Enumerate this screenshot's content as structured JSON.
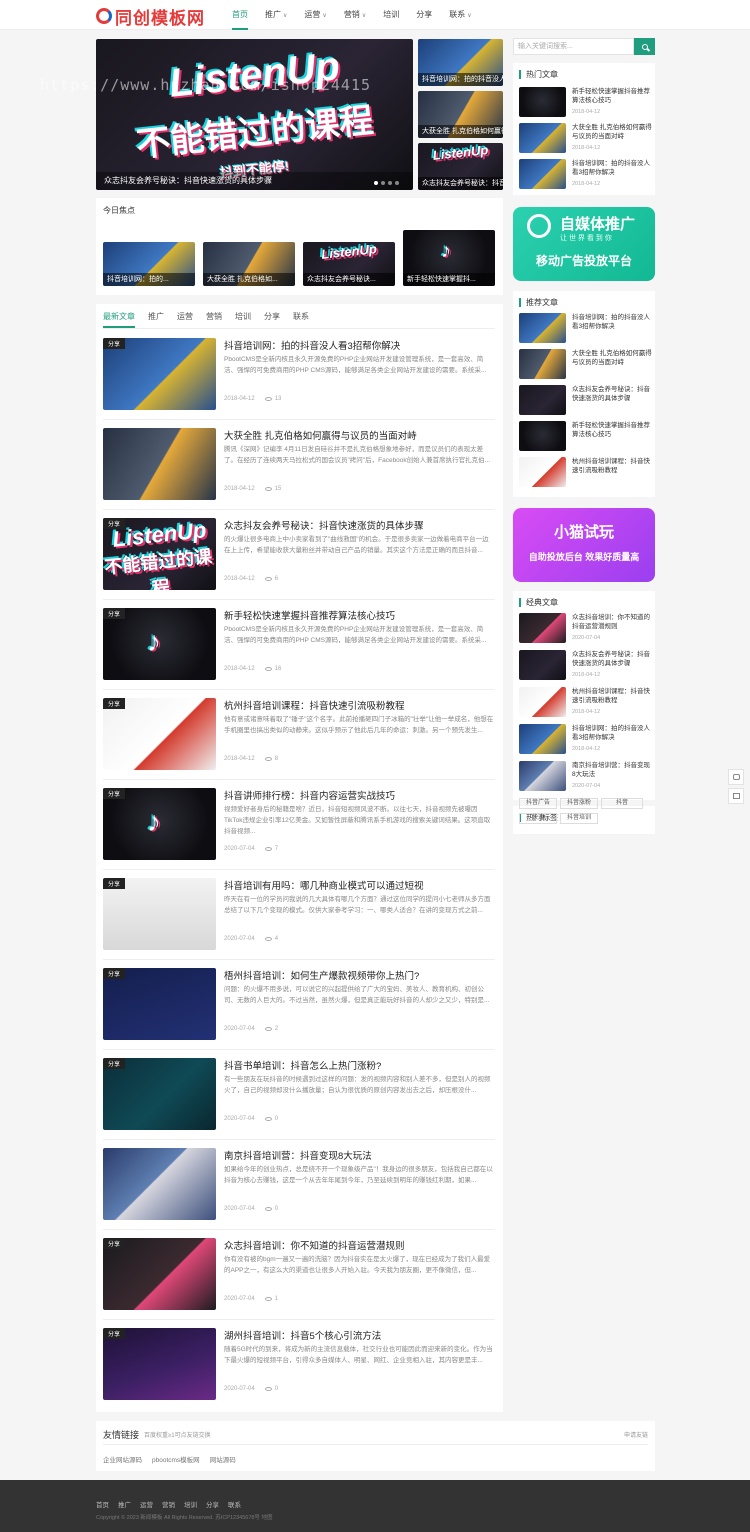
{
  "site": {
    "logo_text": "同创模板网"
  },
  "nav": [
    {
      "label": "首页",
      "active": true,
      "dropdown": false
    },
    {
      "label": "推广",
      "active": false,
      "dropdown": true
    },
    {
      "label": "运营",
      "active": false,
      "dropdown": true
    },
    {
      "label": "营销",
      "active": false,
      "dropdown": true
    },
    {
      "label": "培训",
      "active": false,
      "dropdown": false
    },
    {
      "label": "分享",
      "active": false,
      "dropdown": false
    },
    {
      "label": "联系",
      "active": false,
      "dropdown": true
    }
  ],
  "watermark": "https://www.huzhan.com/ishop24415",
  "slider": {
    "title_line1": "ListenUp",
    "title_line2": "不能错过的课程",
    "title_line3": "抖到不能停!",
    "caption": "众志抖友会养号秘诀：抖音快速涨货的具体步骤",
    "side": [
      {
        "caption": "抖音培训网：拍的抖音没人..."
      },
      {
        "caption": "大获全胜 扎克伯格如何赢得..."
      },
      {
        "caption": "众志抖友会养号秘诀：抖音..."
      }
    ]
  },
  "focus": {
    "title": "今日焦点",
    "items": [
      "抖音培训网：拍的...",
      "大获全胜 扎克伯格如...",
      "众志抖友会养号秘诀...",
      "新手轻松快速掌握抖..."
    ]
  },
  "tabs": [
    "最新文章",
    "推广",
    "运营",
    "营销",
    "培训",
    "分享",
    "联系"
  ],
  "articles": [
    {
      "tag": "分享",
      "title": "抖音培训网：拍的抖音没人看3招帮你解决",
      "desc": "PbootCMS是全新内核且永久开源免费的PHP企业网站开发建设管理系统，是一套高效、简洁、强悍的可免费商用的PHP CMS源码，能够满足各类企业网站开发建设的需要。系统采...",
      "date": "2018-04-12",
      "views": "13"
    },
    {
      "tag": "",
      "title": "大获全胜 扎克伯格如何赢得与议员的当面对峙",
      "desc": "腾讯《深网》记编李 4月11日发自硅谷并不是扎克伯格想象地参好，而是议员们的表现太差了。在经历了连续两天马拉松式的国会议员\"拷问\"后，Facebook创始人兼首席执行官扎克伯...",
      "date": "2018-04-12",
      "views": "15"
    },
    {
      "tag": "分享",
      "title": "众志抖友会养号秘诀：抖音快速涨货的具体步骤",
      "desc": "的火爆让很多电商上中小卖家看到了\"曲线救国\"的机会。于是很多卖家一边做着电商平台一边在上上传，希望能收获大量粉丝并带动自己产品的销量。其实这个方法是正确的而且抖音...",
      "date": "2018-04-12",
      "views": "6"
    },
    {
      "tag": "分享",
      "title": "新手轻松快速掌握抖音推荐算法核心技巧",
      "desc": "PbootCMS是全新内核且永久开源免费的PHP企业网站开发建设管理系统，是一套高效、简洁、强悍的可免费商用的PHP CMS源码，能够满足各类企业网站开发建设的需要。系统采...",
      "date": "2018-04-12",
      "views": "16"
    },
    {
      "tag": "分享",
      "title": "杭州抖音培训课程：抖音快速引流吸粉教程",
      "desc": "他有意或诸意味着取了\"锤子\"这个名字。此前抢播砸四门子冰箱的\"壮举\"让他一举成名，他想在手机圈里也搞出类似的动静来。这似乎预示了他此后几年的命运：刺激。另一个预先发生...",
      "date": "2018-04-12",
      "views": "8"
    },
    {
      "tag": "分享",
      "title": "抖音讲师排行榜：抖音内容运营实战技巧",
      "desc": "视频爱好者身后的秘籍是啥？近日，抖音短视频风波不断。以往七天，抖音视频先被曝因TikTok违规企业引率12亿美金。又如暂性屏蔽和腾讯系手机游戏的搜索关键词结果。这项直取抖音视频...",
      "date": "2020-07-04",
      "views": "7"
    },
    {
      "tag": "分享",
      "title": "抖音培训有用吗：哪几种商业模式可以通过短视",
      "desc": "昨天在有一位的学员问我说的几大具体有哪几个方面？通过这位同学的提问小七老师从多方面总结了以下几个变现的模式。仅供大家参考学习：一、哪类人适合？在讲的变现方式之前...",
      "date": "2020-07-04",
      "views": "4"
    },
    {
      "tag": "分享",
      "title": "梧州抖音培训：如何生产爆款视频带你上热门?",
      "desc": "问题：的火爆不用多说，可以说它的兴起提供给了广大的宝妈、美妆人、教育机构、初创公司、无数的人巨大的。不过当然，虽然火爆，但是真正能玩好抖音的人却少之又少，特别是...",
      "date": "2020-07-04",
      "views": "2"
    },
    {
      "tag": "分享",
      "title": "抖音书单培训：抖音怎么上热门涨粉?",
      "desc": "有一些朋友在玩抖音的时候遇到过这样的问题：发的视频内容和别人差不多，但是别人的视频火了，自己的视频却没什么播放量；自认为很优质的原创内容发出去之后，却压根没什...",
      "date": "2020-07-04",
      "views": "0"
    },
    {
      "tag": "",
      "title": "南京抖音培训营：抖音变现8大玩法",
      "desc": "如果给今年的创业热点，总是绕不开一个现象级产品\"！我身边的很多朋友，包括我自己都在以抖音为核心去赚钱，这是一个从去年年尾到今年，乃至延续到明年的赚钱红利期，如果...",
      "date": "2020-07-04",
      "views": "0"
    },
    {
      "tag": "分享",
      "title": "众志抖音培训：你不知道的抖音运营潜规则",
      "desc": "你有没有被的bgm一遍又一遍的洗脑？因为抖音实在是太火爆了，现在已经成为了我们人最爱的APP之一，有这么大的渠道也让很多人开始入驻。今天我为朋友圈，更不像微信，但...",
      "date": "2020-07-04",
      "views": "1"
    },
    {
      "tag": "分享",
      "title": "湖州抖音培训：抖音5个核心引流方法",
      "desc": "随着5G时代的到来，将成为新的主流信息载体，社交行业也可能因此而迎来新的变化。作为当下最火爆的短视频平台，引得众多自媒体人、明星、网红、企业竞相入驻，其内容更是丰...",
      "date": "2020-07-04",
      "views": "0"
    }
  ],
  "search": {
    "placeholder": "输入关键词搜索..."
  },
  "hot": {
    "title": "热门文章",
    "items": [
      {
        "title": "新手轻松快速掌握抖音推荐算法核心技巧",
        "date": "2018-04-12"
      },
      {
        "title": "大获全胜 扎克伯格如何赢得与议员的当面对峙",
        "date": "2018-04-12"
      },
      {
        "title": "抖音培训网：拍的抖音没人看3招帮你解决",
        "date": "2018-04-12"
      }
    ]
  },
  "ad1": {
    "title": "自媒体推广",
    "sub": "让 世 界 看 到 你",
    "line": "移动广告投放平台",
    "color": "#19c4a1"
  },
  "recommend": {
    "title": "推荐文章",
    "items": [
      {
        "title": "抖音培训网：拍的抖音没人看3招帮你解决"
      },
      {
        "title": "大获全胜 扎克伯格如何赢得与议员的当面对峙"
      },
      {
        "title": "众志抖友会养号秘诀：抖音快速涨货的具体步骤"
      },
      {
        "title": "新手轻松快速掌握抖音推荐算法核心技巧"
      },
      {
        "title": "杭州抖音培训课程：抖音快速引流吸粉教程"
      }
    ]
  },
  "ad2": {
    "title": "小猫试玩",
    "line": "自助投放后台 效果好质量高",
    "color": "#b43df0"
  },
  "classic": {
    "title": "经典文章",
    "items": [
      {
        "title": "众志抖音培训：你不知道的抖音运营潜规则",
        "date": "2020-07-04"
      },
      {
        "title": "众志抖友会养号秘诀：抖音快速涨货的具体步骤",
        "date": "2018-04-12"
      },
      {
        "title": "杭州抖音培训课程：抖音快速引流吸粉教程",
        "date": "2018-04-12"
      },
      {
        "title": "抖音培训网：拍的抖音没人看3招帮你解决",
        "date": "2018-04-12"
      },
      {
        "title": "南京抖音培训营：抖音变现8大玩法",
        "date": "2020-07-04"
      }
    ]
  },
  "hottags": {
    "title": "热门标签",
    "items": [
      "抖音广告",
      "抖音涨粉",
      "抖音",
      "快速",
      "抖音培训"
    ]
  },
  "links": {
    "title": "友情链接",
    "subtitle": "百度权重≥1可点友链交换",
    "apply": "申请友链",
    "items": [
      "企业网站源码",
      "pbootcms模板网",
      "网站源码"
    ]
  },
  "footer": {
    "nav": [
      "首页",
      "推广",
      "运营",
      "营销",
      "培训",
      "分享",
      "联系"
    ],
    "copyright": "Copyright © 2023 新闻模板 All Rights Reserved. 苏ICP12345678号 地图"
  }
}
